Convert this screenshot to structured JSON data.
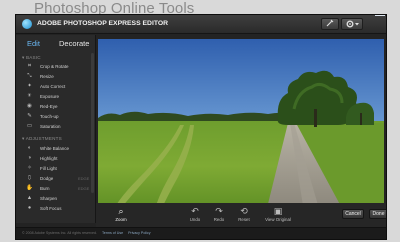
{
  "page": {
    "title": "Photoshop Online Tools"
  },
  "app": {
    "title": "ADOBE PHOTOSHOP EXPRESS EDITOR",
    "toolbar_icons": [
      "tools-icon",
      "gear-icon"
    ],
    "close_label": "×"
  },
  "sidebar": {
    "tabs": [
      {
        "label": "Edit",
        "active": true
      },
      {
        "label": "Decorate",
        "active": false
      }
    ],
    "basic_header": "BASIC",
    "basic_items": [
      {
        "label": "Crop & Rotate",
        "icon": "crop-icon"
      },
      {
        "label": "Resize",
        "icon": "resize-icon"
      },
      {
        "label": "Auto Correct",
        "icon": "auto-correct-icon"
      },
      {
        "label": "Exposure",
        "icon": "exposure-icon"
      },
      {
        "label": "Red-Eye",
        "icon": "red-eye-icon"
      },
      {
        "label": "Touch-up",
        "icon": "touch-up-icon"
      },
      {
        "label": "Saturation",
        "icon": "saturation-icon"
      }
    ],
    "adjustments_header": "ADJUSTMENTS",
    "adjustment_items": [
      {
        "label": "White Balance",
        "icon": "white-balance-icon",
        "hint": ""
      },
      {
        "label": "Highlight",
        "icon": "highlight-icon",
        "hint": ""
      },
      {
        "label": "Fill Light",
        "icon": "fill-light-icon",
        "hint": ""
      },
      {
        "label": "Dodge",
        "icon": "dodge-icon",
        "hint": "EDGE"
      },
      {
        "label": "Burn",
        "icon": "burn-icon",
        "hint": "EDGE"
      },
      {
        "label": "Sharpen",
        "icon": "sharpen-icon",
        "hint": ""
      },
      {
        "label": "Soft Focus",
        "icon": "soft-focus-icon",
        "hint": ""
      }
    ]
  },
  "bottom_bar": {
    "zoom": "Zoom",
    "undo": "Undo",
    "redo": "Redo",
    "reset": "Reset",
    "view_original": "View Original",
    "cancel": "Cancel",
    "done": "Done"
  },
  "footer": {
    "copyright": "© 2008 Adobe Systems Inc. All rights reserved.",
    "terms": "Terms of Use",
    "privacy": "Privacy Policy"
  },
  "colors": {
    "accent": "#6ab7f2",
    "close_button": "#1a74c8"
  }
}
